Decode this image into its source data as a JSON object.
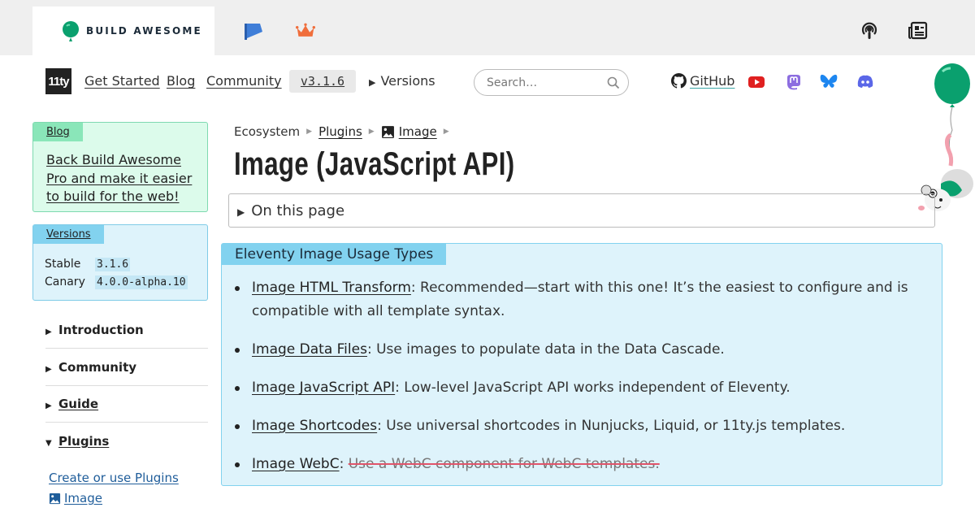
{
  "topstrip": {
    "brand": "BUILD AWESOME",
    "icons": [
      "flag-icon",
      "crown-icon",
      "podcast-icon",
      "newspaper-icon"
    ]
  },
  "nav": {
    "logo": "11ty",
    "links": [
      "Get Started",
      "Blog",
      "Community"
    ],
    "version": "v3.1.6",
    "versions_toggle": "Versions",
    "search_placeholder": "Search…",
    "github": "GitHub",
    "social_icons": [
      "youtube-icon",
      "mastodon-icon",
      "bluesky-icon",
      "discord-icon"
    ]
  },
  "sidebar": {
    "blog_card": {
      "label": "Blog",
      "text": "Back Build Awesome Pro and make it easier to build for the web!"
    },
    "versions_card": {
      "label": "Versions",
      "stable_label": "Stable",
      "stable": "3.1.6",
      "canary_label": "Canary",
      "canary": "4.0.0-alpha.10"
    },
    "sections": [
      "Introduction",
      "Community",
      "Guide",
      "Plugins"
    ],
    "plugin_links": [
      "Create or use Plugins",
      "Image"
    ]
  },
  "main": {
    "breadcrumb": [
      "Ecosystem",
      "Plugins",
      "Image"
    ],
    "title": "Image (JavaScript API)",
    "on_this_page": "On this page",
    "usage_box": {
      "label": "Eleventy Image Usage Types",
      "items": [
        {
          "link": "Image HTML Transform",
          "text": ": Recommended—start with this one! It’s the easiest to configure and is compatible with all template syntax."
        },
        {
          "link": "Image Data Files",
          "text": ": Use images to populate data in the Data Cascade."
        },
        {
          "link": "Image JavaScript API",
          "text": ": Low-level JavaScript API works independent of Eleventy."
        },
        {
          "link": "Image Shortcodes",
          "text": ": Use universal shortcodes in Nunjucks, Liquid, or 11ty.js templates."
        },
        {
          "link": "Image WebC",
          "text": ":",
          "struck": "Use a WebC component for WebC templates."
        }
      ]
    }
  },
  "colors": {
    "brand_green": "#0aa06e",
    "blog_bg": "#dcfbeb",
    "versions_bg": "#def3fb",
    "strike": "#e0546a"
  }
}
